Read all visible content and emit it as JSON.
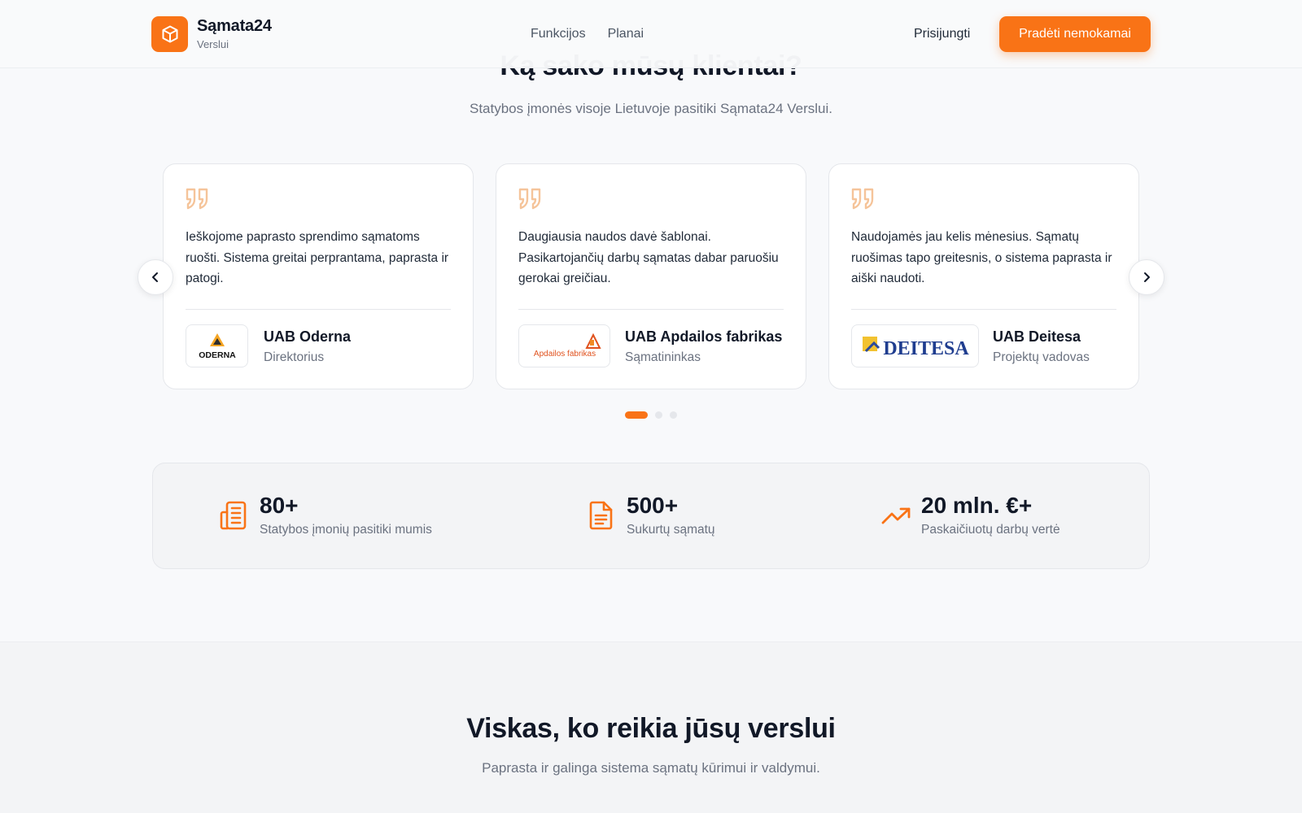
{
  "header": {
    "brand_name": "Sąmata24",
    "brand_sub": "Verslui",
    "nav": [
      "Funkcijos",
      "Planai"
    ],
    "login": "Prisijungti",
    "cta": "Pradėti nemokamai"
  },
  "testimonials": {
    "title": "Ką sako mūsų klientai?",
    "subtitle": "Statybos įmonės visoje Lietuvoje pasitiki Sąmata24 Verslui.",
    "items": [
      {
        "quote": "Ieškojome paprasto sprendimo sąmatoms ruošti. Sistema greitai perprantama, paprasta ir patogi.",
        "company": "UAB Oderna",
        "role": "Direktorius",
        "logo_text": "ODERNA"
      },
      {
        "quote": "Daugiausia naudos davė šablonai. Pasikartojančių darbų sąmatas dabar paruošiu gerokai greičiau.",
        "company": "UAB Apdailos fabrikas",
        "role": "Sąmatininkas",
        "logo_text": "Apdailos fabrikas"
      },
      {
        "quote": "Naudojamės jau kelis mėnesius. Sąmatų ruošimas tapo greitesnis, o sistema paprasta ir aiški naudoti.",
        "company": "UAB Deitesa",
        "role": "Projektų vadovas",
        "logo_text": "DEITESA"
      }
    ],
    "active_slide": 1,
    "slide_count": 3
  },
  "stats": [
    {
      "icon": "building-icon",
      "value": "80+",
      "label": "Statybos įmonių pasitiki mumis"
    },
    {
      "icon": "document-icon",
      "value": "500+",
      "label": "Sukurtų sąmatų"
    },
    {
      "icon": "trend-up-icon",
      "value": "20 mln. €+",
      "label": "Paskaičiuotų darbų vertė"
    }
  ],
  "features": {
    "title": "Viskas, ko reikia jūsų verslui",
    "subtitle": "Paprasta ir galinga sistema sąmatų kūrimui ir valdymui."
  },
  "colors": {
    "accent": "#f97316",
    "text": "#111827",
    "muted": "#6b7280",
    "quote_mark": "#f5c49a"
  }
}
